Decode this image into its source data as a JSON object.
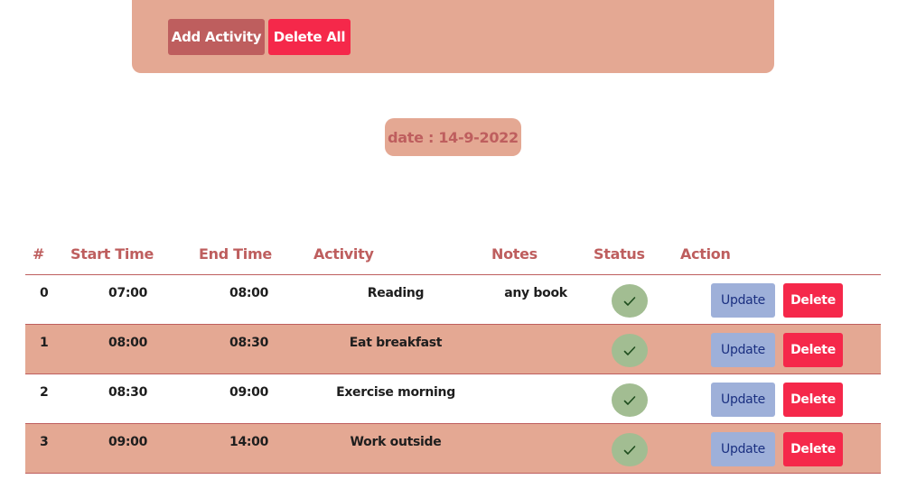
{
  "toolbar": {
    "add_label": "Add Activity",
    "delete_all_label": "Delete All"
  },
  "date_label": "date : 14-9-2022",
  "table": {
    "headers": [
      "#",
      "Start Time",
      "End Time",
      "Activity",
      "Notes",
      "Status",
      "Action"
    ],
    "update_label": "Update",
    "delete_label": "Delete",
    "rows": [
      {
        "idx": "0",
        "start": "07:00",
        "end": "08:00",
        "activity": "Reading",
        "notes": "any book",
        "done": true
      },
      {
        "idx": "1",
        "start": "08:00",
        "end": "08:30",
        "activity": "Eat breakfast",
        "notes": "",
        "done": true
      },
      {
        "idx": "2",
        "start": "08:30",
        "end": "09:00",
        "activity": "Exercise morning",
        "notes": "",
        "done": true
      },
      {
        "idx": "3",
        "start": "09:00",
        "end": "14:00",
        "activity": "Work outside",
        "notes": "",
        "done": true
      }
    ]
  },
  "colors": {
    "accent": "#be5e5e",
    "panel": "#e4a893",
    "danger": "#f5284a",
    "status_done": "#a2bd92",
    "update": "#9eb0d9"
  },
  "icons": {
    "status": "check-icon"
  }
}
